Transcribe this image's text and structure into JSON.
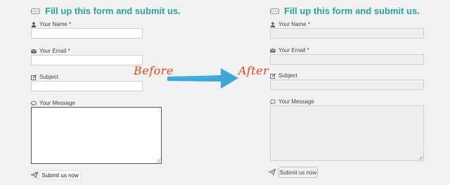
{
  "form": {
    "title": "Fill up this form and submit us.",
    "name_label": "Your Name *",
    "email_label": "Your Email *",
    "subject_label": "Subject",
    "message_label": "Your Message",
    "submit_label": "Submit us now"
  },
  "annotation": {
    "before": "Before",
    "after": "After",
    "arrow_color": "#2a9fd6"
  },
  "icons": [
    "keyboard-icon",
    "user-icon",
    "envelope-icon",
    "edit-icon",
    "comment-icon",
    "paper-plane-icon"
  ]
}
